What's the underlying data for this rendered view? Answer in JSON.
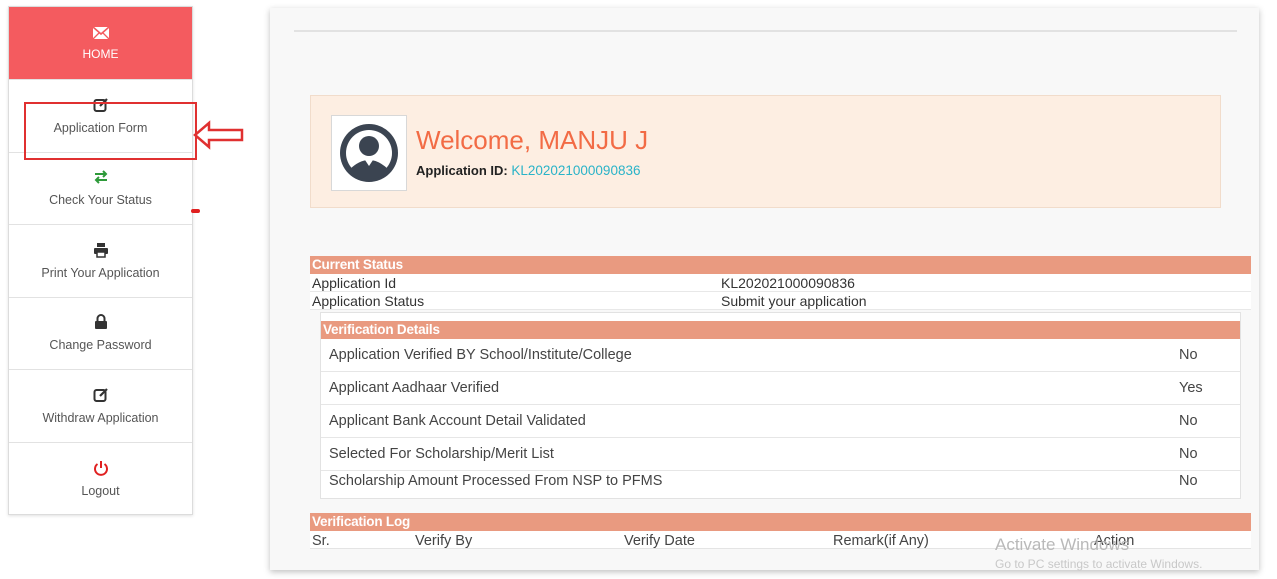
{
  "sidebar": {
    "items": [
      {
        "label": "HOME",
        "icon": "envelope-icon"
      },
      {
        "label": "Application Form",
        "icon": "edit-icon"
      },
      {
        "label": "Check Your Status",
        "icon": "exchange-icon"
      },
      {
        "label": "Print Your Application",
        "icon": "print-icon"
      },
      {
        "label": "Change Password",
        "icon": "lock-icon"
      },
      {
        "label": "Withdraw Application",
        "icon": "edit-icon"
      },
      {
        "label": "Logout",
        "icon": "power-icon"
      }
    ],
    "active_color": "#f45b5f"
  },
  "welcome": {
    "title": "Welcome, MANJU J",
    "app_id_label": "Application ID:",
    "app_id_value": "KL202021000090836",
    "title_color": "#f26b45",
    "id_color": "#2ab3c8"
  },
  "status": {
    "header": "Current Status",
    "rows": [
      {
        "key": "Application Id",
        "value": "KL202021000090836"
      },
      {
        "key": "Application Status",
        "value": "Submit your application"
      }
    ],
    "band_color": "#e99a80"
  },
  "verification": {
    "header": "Verification Details",
    "rows": [
      {
        "label": "Application Verified BY School/Institute/College",
        "value": "No"
      },
      {
        "label": "Applicant Aadhaar Verified",
        "value": "Yes"
      },
      {
        "label": "Applicant Bank Account Detail Validated",
        "value": "No"
      },
      {
        "label": "Selected For Scholarship/Merit List",
        "value": "No"
      },
      {
        "label": "Scholarship Amount Processed From NSP to PFMS",
        "value": "No"
      }
    ]
  },
  "log": {
    "header": "Verification Log",
    "columns": [
      "Sr.",
      "Verify By",
      "Verify Date",
      "Remark(if Any)",
      "Action"
    ]
  },
  "watermark": {
    "line1": "Activate Windows",
    "line2": "Go to PC settings to activate Windows."
  }
}
